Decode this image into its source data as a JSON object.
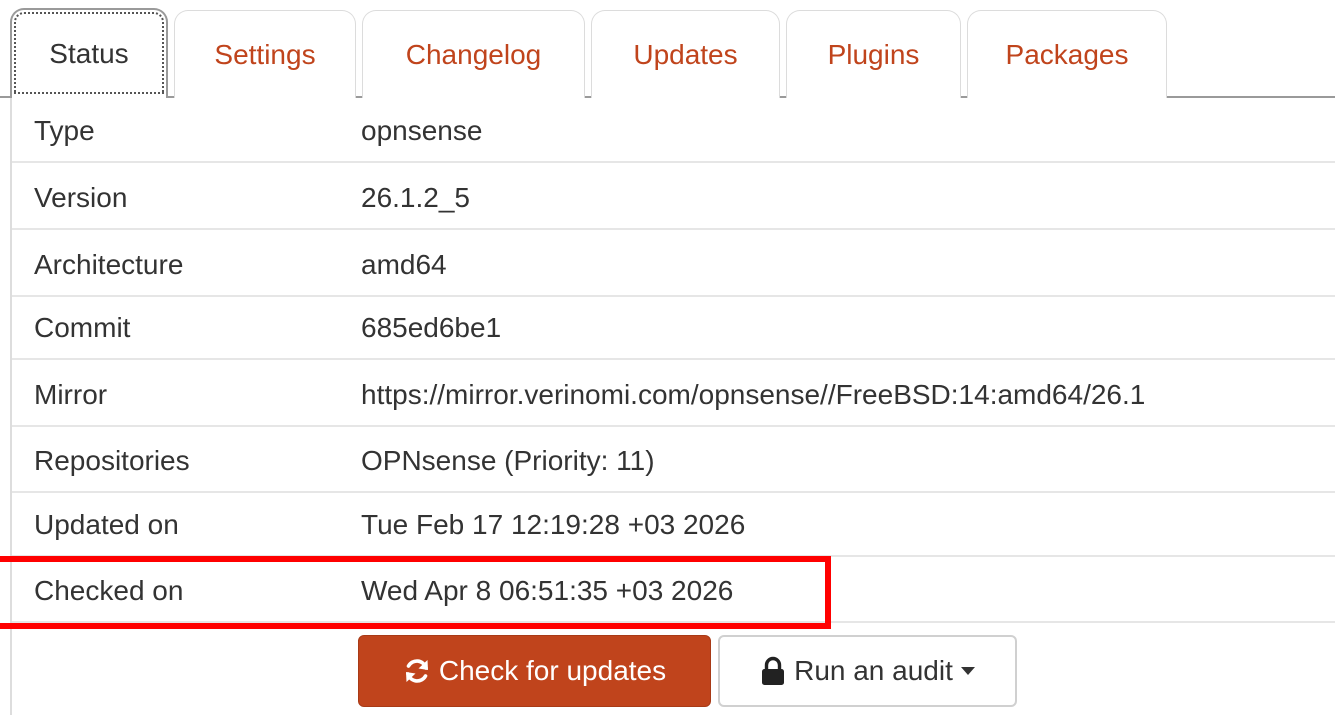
{
  "tabs": [
    {
      "label": "Status",
      "active": true
    },
    {
      "label": "Settings",
      "active": false
    },
    {
      "label": "Changelog",
      "active": false
    },
    {
      "label": "Updates",
      "active": false
    },
    {
      "label": "Plugins",
      "active": false
    },
    {
      "label": "Packages",
      "active": false
    }
  ],
  "status_rows": [
    {
      "label": "Type",
      "value": "opnsense"
    },
    {
      "label": "Version",
      "value": "26.1.2_5"
    },
    {
      "label": "Architecture",
      "value": "amd64"
    },
    {
      "label": "Commit",
      "value": "685ed6be1"
    },
    {
      "label": "Mirror",
      "value": "https://mirror.verinomi.com/opnsense//FreeBSD:14:amd64/26.1"
    },
    {
      "label": "Repositories",
      "value": "OPNsense (Priority: 11)"
    },
    {
      "label": "Updated on",
      "value": "Tue Feb 17 12:19:28 +03 2026"
    },
    {
      "label": "Checked on",
      "value": "Wed Apr 8 06:51:35 +03 2026"
    }
  ],
  "actions": {
    "check_updates": {
      "label": "Check for updates",
      "icon": "refresh-icon"
    },
    "run_audit": {
      "label": "Run an audit",
      "icon": "lock-icon"
    }
  },
  "colors": {
    "accent": "#c0441c",
    "highlight": "#ff0000"
  }
}
